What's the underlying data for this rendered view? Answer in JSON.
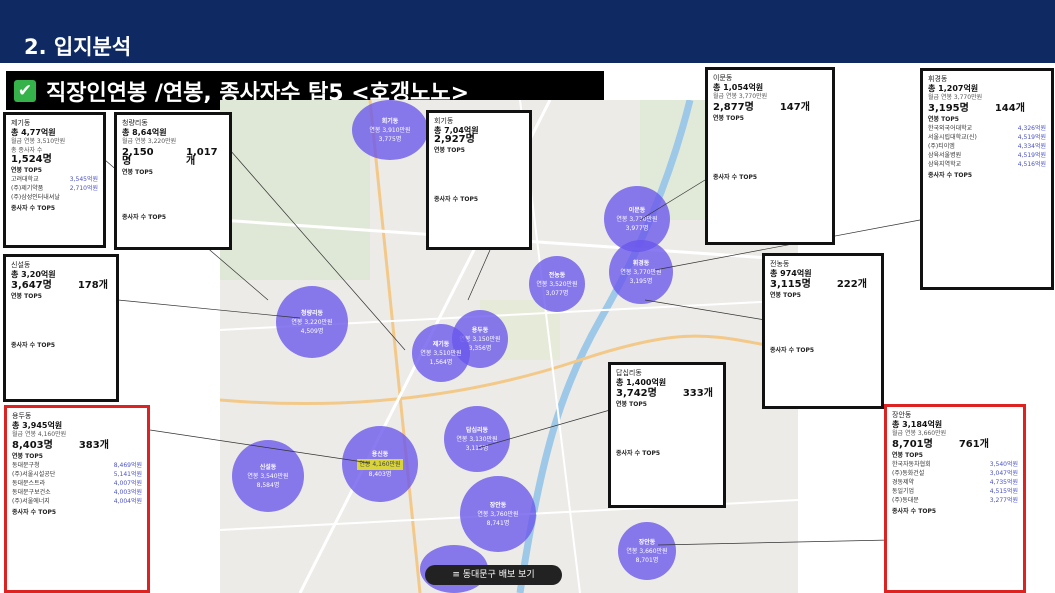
{
  "slide": {
    "section_title": "2. 입지분석",
    "headline": "직장인연봉 /연봉, 종사자수 탑5 <호갱노노>",
    "accent_color": "#0f2a63"
  },
  "map": {
    "button_label": "≡ 동대문구 배보 보기",
    "bubbles": [
      {
        "name": "회기동",
        "salary": "연봉 3,910만원",
        "workers": "3,775명"
      },
      {
        "name": "이문동",
        "salary": "연봉 3,770만원",
        "workers": "3,977명"
      },
      {
        "name": "휘경동",
        "salary": "연봉 3,770만원",
        "workers": "3,195명"
      },
      {
        "name": "청량리동",
        "salary": "연봉 3,220만원",
        "workers": "4,509명"
      },
      {
        "name": "용두동",
        "salary": "연봉 3,150만원",
        "workers": "3,356명"
      },
      {
        "name": "제기동",
        "salary": "연봉 3,510만원",
        "workers": "1,564명"
      },
      {
        "name": "전농동",
        "salary": "연봉 3,520만원",
        "workers": "3,077명"
      },
      {
        "name": "답십리동",
        "salary": "연봉 3,130만원",
        "workers": "3,115명"
      },
      {
        "name": "용신동",
        "salary": "연봉 4,160만원",
        "workers": "8,403명"
      },
      {
        "name": "신설동",
        "salary": "연봉 3,540만원",
        "workers": "8,584명"
      },
      {
        "name": "장안동",
        "salary": "연봉 3,760만원",
        "workers": "8,741명"
      },
      {
        "name": "장안동",
        "salary": "연봉 3,660만원",
        "workers": "8,701명"
      }
    ]
  },
  "cards": {
    "jegi": {
      "title": "제기동",
      "salary": "총 4,77억원",
      "sub": "월급 연봉 3,510만원",
      "workers": "1,524명",
      "biz": "",
      "top": [
        "고려대학교",
        "(주)제기약품",
        "(주)삼성인터내셔날"
      ],
      "vals": [
        "3,545억원",
        "2,710억원",
        ""
      ]
    },
    "cheongnyangni": {
      "title": "청량리동",
      "salary": "총 8,64억원",
      "sub": "월급 연봉 3,220만원",
      "workers": "2,150명",
      "biz": "1,017개"
    },
    "hoegi": {
      "title": "회기동",
      "salary": "총 7,04억원",
      "sub": "",
      "workers": "2,927명",
      "biz": ""
    },
    "imun": {
      "title": "이문동",
      "salary": "총 1,054억원",
      "sub": "월급 연봉 3,770만원",
      "workers": "2,877명",
      "biz": "147개"
    },
    "hwigyeong": {
      "title": "휘경동",
      "salary": "총 1,207억원",
      "sub": "월급 연봉 3,770만원",
      "workers": "3,195명",
      "biz": "144개",
      "top": [
        "한국외국어대학교",
        "서울시립대학교(신)",
        "(주)티이엠",
        "삼육서울병원",
        "삼육지역학교"
      ],
      "vals": [
        "4,326억원",
        "4,519억원",
        "4,334억원",
        "4,519억원",
        "4,516억원"
      ]
    },
    "sinseol": {
      "title": "신설동",
      "salary": "총 3,20억원",
      "sub": "",
      "workers": "3,647명",
      "biz": "178개"
    },
    "jeonnong": {
      "title": "전농동",
      "salary": "총 974억원",
      "sub": "",
      "workers": "3,115명",
      "biz": "222개"
    },
    "dapsimni": {
      "title": "답십리동",
      "salary": "총 1,400억원",
      "sub": "",
      "workers": "3,742명",
      "biz": "333개"
    },
    "yongdu": {
      "title": "용두동",
      "salary": "총 3,945억원",
      "sub": "월급 연봉 4,160만원",
      "workers": "8,403명",
      "biz": "383개",
      "top": [
        "동대문구청",
        "(주)서울시설공단",
        "동대문스트라",
        "동대문구보건소",
        "(주)서울에너지"
      ],
      "vals": [
        "8,469억원",
        "5,141억원",
        "4,007억원",
        "4,003억원",
        "4,004억원"
      ]
    },
    "jangan": {
      "title": "장안동",
      "salary": "총 3,184억원",
      "sub": "월급 연봉 3,660만원",
      "workers": "8,701명",
      "biz": "761개",
      "top": [
        "한국자동차협회",
        "(주)동화건설",
        "경동제약",
        "동일기업",
        "(주)동대문"
      ],
      "vals": [
        "3,540억원",
        "3,047억원",
        "4,735억원",
        "4,515억원",
        "3,277억원"
      ]
    }
  },
  "labels": {
    "workers_label": "총 종사자 수",
    "biz_label": "총 사업체 수",
    "salary_top": "연봉 TOP5",
    "workers_top": "종사자 수 TOP5"
  }
}
